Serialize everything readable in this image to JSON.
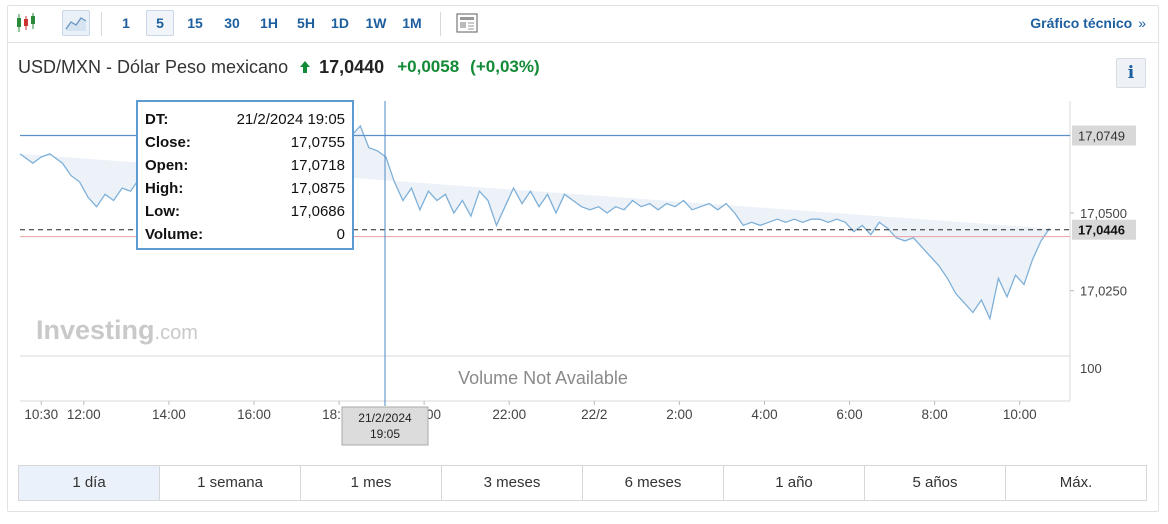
{
  "toolbar": {
    "timeframes": [
      {
        "label": "1",
        "active": false
      },
      {
        "label": "5",
        "active": true
      },
      {
        "label": "15",
        "active": false
      },
      {
        "label": "30",
        "active": false
      },
      {
        "label": "1H",
        "active": false
      },
      {
        "label": "5H",
        "active": false
      },
      {
        "label": "1D",
        "active": false
      },
      {
        "label": "1W",
        "active": false
      },
      {
        "label": "1M",
        "active": false
      }
    ],
    "technical_link": "Gráfico técnico",
    "technical_chevron": "»"
  },
  "header": {
    "pair": "USD/MXN - Dólar Peso mexicano",
    "price": "17,0440",
    "change": "+0,0058",
    "change_pct": "(+0,03%)",
    "info_label": "i"
  },
  "colors": {
    "accent": "#1d5f9e",
    "line": "#7fb0d8",
    "area": "#e9f0f7",
    "positive": "#138a36",
    "hline": "#5b8fc7",
    "prev_close": "#e8a0a0"
  },
  "tooltip": {
    "rows": [
      {
        "key": "DT:",
        "value": "21/2/2024 19:05"
      },
      {
        "key": "Close:",
        "value": "17,0755"
      },
      {
        "key": "Open:",
        "value": "17,0718"
      },
      {
        "key": "High:",
        "value": "17,0875"
      },
      {
        "key": "Low:",
        "value": "17,0686"
      },
      {
        "key": "Volume:",
        "value": "0"
      }
    ]
  },
  "watermark": {
    "brand": "Investing",
    "suffix": ".com"
  },
  "volume_text": "Volume Not Available",
  "chart_data": {
    "type": "area",
    "title": "USD/MXN - Dólar Peso mexicano",
    "xlabel": "",
    "ylabel": "",
    "ylim": [
      17.004,
      17.086
    ],
    "y_ticks": [
      {
        "value": 17.05,
        "label": "17,0500"
      },
      {
        "value": 17.025,
        "label": "17,0250"
      }
    ],
    "volume_tick": "100",
    "x_ticks": [
      {
        "h": 0.5,
        "label": "10:30"
      },
      {
        "h": 1.5,
        "label": "12:00"
      },
      {
        "h": 3.5,
        "label": "14:00"
      },
      {
        "h": 5.5,
        "label": "16:00"
      },
      {
        "h": 7.5,
        "label": "18:00"
      },
      {
        "h": 9.5,
        "label": "20:00"
      },
      {
        "h": 11.5,
        "label": "22:00"
      },
      {
        "h": 13.5,
        "label": "22/2"
      },
      {
        "h": 15.5,
        "label": "2:00"
      },
      {
        "h": 17.5,
        "label": "4:00"
      },
      {
        "h": 19.5,
        "label": "6:00"
      },
      {
        "h": 21.5,
        "label": "8:00"
      },
      {
        "h": 23.5,
        "label": "10:00"
      }
    ],
    "x_unit_note": "x values are hours elapsed since 10:30 on 21/2/2024",
    "x": [
      0,
      0.3,
      0.5,
      0.7,
      1,
      1.2,
      1.4,
      1.6,
      1.8,
      2,
      2.2,
      2.4,
      2.6,
      2.8,
      3,
      3.2,
      3.4,
      3.6,
      3.8,
      4,
      4.2,
      4.4,
      4.6,
      4.8,
      5,
      5.2,
      5.4,
      5.6,
      5.8,
      6,
      6.2,
      6.4,
      6.6,
      6.8,
      7,
      7.2,
      7.4,
      7.6,
      7.8,
      8,
      8.2,
      8.4,
      8.6,
      8.8,
      9,
      9.2,
      9.4,
      9.6,
      9.8,
      10,
      10.2,
      10.4,
      10.6,
      10.8,
      11,
      11.2,
      11.4,
      11.6,
      11.8,
      12,
      12.2,
      12.4,
      12.6,
      12.8,
      13,
      13.2,
      13.4,
      13.6,
      13.8,
      14,
      14.2,
      14.4,
      14.6,
      14.8,
      15,
      15.2,
      15.4,
      15.6,
      15.8,
      16,
      16.2,
      16.4,
      16.6,
      16.8,
      17,
      17.2,
      17.4,
      17.6,
      17.8,
      18,
      18.2,
      18.4,
      18.6,
      18.8,
      19,
      19.2,
      19.4,
      19.6,
      19.8,
      20,
      20.2,
      20.4,
      20.6,
      20.8,
      21,
      21.2,
      21.4,
      21.6,
      21.8,
      22,
      22.2,
      22.4,
      22.6,
      22.8,
      23,
      23.2,
      23.4,
      23.6,
      23.8,
      24,
      24.2,
      24.4
    ],
    "series": [
      {
        "values": [
          17.069,
          17.066,
          17.068,
          17.069,
          17.066,
          17.062,
          17.06,
          17.055,
          17.052,
          17.056,
          17.054,
          17.058,
          17.057,
          17.061,
          17.066,
          17.07,
          17.069,
          17.071,
          17.068,
          17.067,
          17.07,
          17.069,
          17.072,
          17.068,
          17.066,
          17.069,
          17.067,
          17.071,
          17.069,
          17.072,
          17.07,
          17.069,
          17.071,
          17.068,
          17.07,
          17.067,
          17.074,
          17.069,
          17.075,
          17.078,
          17.071,
          17.07,
          17.068,
          17.06,
          17.054,
          17.058,
          17.051,
          17.057,
          17.054,
          17.056,
          17.05,
          17.054,
          17.049,
          17.057,
          17.054,
          17.046,
          17.052,
          17.058,
          17.053,
          17.057,
          17.052,
          17.056,
          17.05,
          17.056,
          17.054,
          17.052,
          17.051,
          17.052,
          17.05,
          17.052,
          17.051,
          17.054,
          17.052,
          17.053,
          17.051,
          17.053,
          17.052,
          17.054,
          17.051,
          17.052,
          17.053,
          17.051,
          17.053,
          17.05,
          17.046,
          17.047,
          17.046,
          17.047,
          17.048,
          17.047,
          17.048,
          17.047,
          17.048,
          17.048,
          17.047,
          17.048,
          17.047,
          17.044,
          17.046,
          17.043,
          17.047,
          17.045,
          17.042,
          17.041,
          17.042,
          17.039,
          17.036,
          17.033,
          17.029,
          17.024,
          17.021,
          17.018,
          17.022,
          17.016,
          17.029,
          17.023,
          17.03,
          17.027,
          17.035,
          17.041,
          17.045
        ]
      }
    ],
    "hlines": [
      {
        "value": 17.0749,
        "label": "17,0749",
        "style": "solid"
      },
      {
        "value": 17.0446,
        "label": "17,0446",
        "style": "dashed"
      },
      {
        "value": 17.0424,
        "label": "",
        "style": "prev-close"
      }
    ],
    "crosshair": {
      "x": 8.58,
      "label_date": "21/2/2024",
      "label_time": "19:05"
    },
    "grid": false,
    "legend": "none"
  },
  "range_buttons": [
    {
      "label": "1 día",
      "active": true
    },
    {
      "label": "1 semana",
      "active": false
    },
    {
      "label": "1 mes",
      "active": false
    },
    {
      "label": "3 meses",
      "active": false
    },
    {
      "label": "6 meses",
      "active": false
    },
    {
      "label": "1 año",
      "active": false
    },
    {
      "label": "5 años",
      "active": false
    },
    {
      "label": "Máx.",
      "active": false
    }
  ]
}
